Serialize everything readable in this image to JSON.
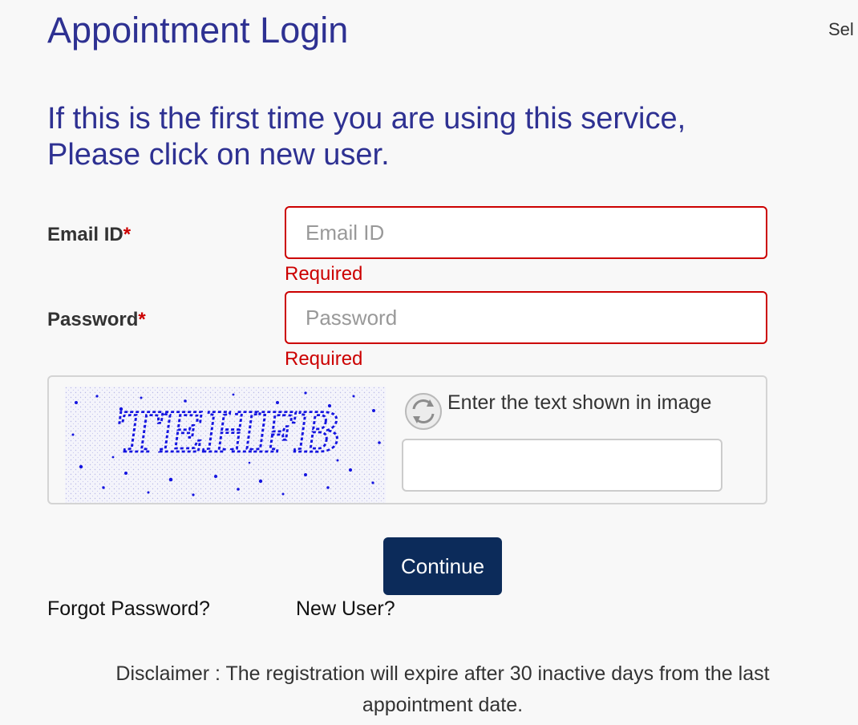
{
  "header": {
    "title": "Appointment Login",
    "top_right_text": "Sel"
  },
  "intro": {
    "line1": "If this is the first time you are using this service,",
    "line2": "Please click on new user."
  },
  "form": {
    "email": {
      "label": "Email ID",
      "required_mark": "*",
      "placeholder": "Email ID",
      "value": "",
      "error": "Required"
    },
    "password": {
      "label": "Password",
      "required_mark": "*",
      "placeholder": "Password",
      "value": "",
      "error": "Required"
    },
    "captcha": {
      "image_text": "TEHFB",
      "prompt": "Enter the text shown in image",
      "value": "",
      "refresh_icon": "refresh-icon"
    },
    "continue_label": "Continue"
  },
  "links": {
    "forgot_password": "Forgot Password?",
    "new_user": "New User?"
  },
  "disclaimer": {
    "line1": "Disclaimer : The registration will expire after 30 inactive days from the last",
    "line2": "appointment date."
  },
  "colors": {
    "heading": "#2e3192",
    "error": "#cc0000",
    "button": "#0c2b5a",
    "captcha_text": "#1a1ae6"
  }
}
